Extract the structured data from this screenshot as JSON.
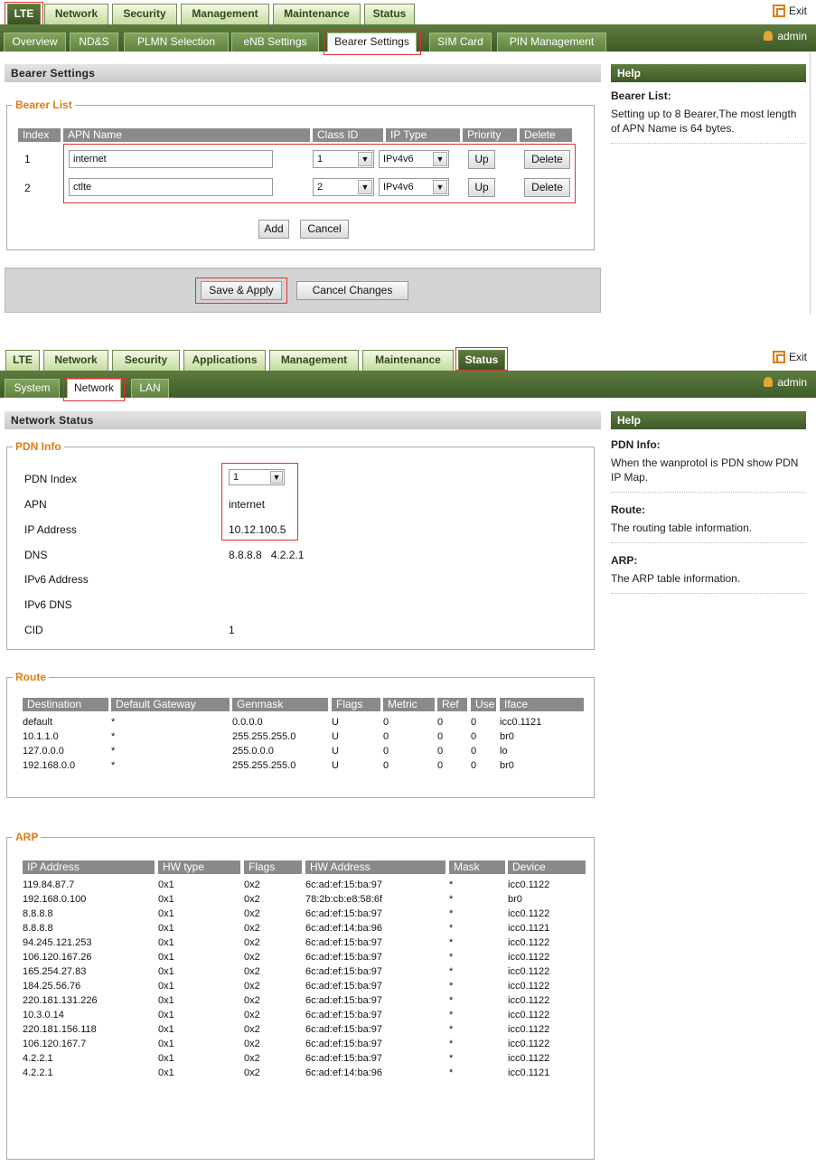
{
  "screen1": {
    "top_tabs": [
      "LTE",
      "Network",
      "Security",
      "Management",
      "Maintenance",
      "Status"
    ],
    "exit_label": "Exit",
    "sub_tabs": [
      "Overview",
      "ND&S",
      "PLMN Selection",
      "eNB Settings",
      "Bearer Settings",
      "SIM Card",
      "PIN Management"
    ],
    "admin_label": "admin",
    "section_title": "Bearer Settings",
    "help_title": "Help",
    "help_items": [
      {
        "heading": "Bearer List:",
        "text": "Setting up to 8 Bearer,The most length of APN Name is 64 bytes."
      }
    ],
    "bearer_legend": "Bearer List",
    "bearer_headers": [
      "Index",
      "APN Name",
      "Class ID",
      "IP Type",
      "Priority",
      "Delete"
    ],
    "bearer_rows": [
      {
        "index": "1",
        "apn": "internet",
        "class_id": "1",
        "ip_type": "IPv4v6",
        "priority": "Up",
        "delete": "Delete"
      },
      {
        "index": "2",
        "apn": "ctlte",
        "class_id": "2",
        "ip_type": "IPv4v6",
        "priority": "Up",
        "delete": "Delete"
      }
    ],
    "add_label": "Add",
    "cancel_label": "Cancel",
    "save_label": "Save & Apply",
    "cancel_changes_label": "Cancel Changes"
  },
  "screen2": {
    "top_tabs": [
      "LTE",
      "Network",
      "Security",
      "Applications",
      "Management",
      "Maintenance",
      "Status"
    ],
    "exit_label": "Exit",
    "sub_tabs": [
      "System",
      "Network",
      "LAN"
    ],
    "admin_label": "admin",
    "section_title": "Network Status",
    "help_title": "Help",
    "help_items": [
      {
        "heading": "PDN Info:",
        "text": "When the wanprotol is PDN show PDN IP Map."
      },
      {
        "heading": "Route:",
        "text": "The routing table information."
      },
      {
        "heading": "ARP:",
        "text": "The ARP table information."
      }
    ],
    "pdn_legend": "PDN Info",
    "pdn_fields": [
      {
        "label": "PDN Index",
        "value": "1"
      },
      {
        "label": "APN",
        "value": "internet"
      },
      {
        "label": "IP Address",
        "value": "10.12.100.5"
      },
      {
        "label": "DNS",
        "value": "8.8.8.8   4.2.2.1"
      },
      {
        "label": "IPv6 Address",
        "value": ""
      },
      {
        "label": "IPv6 DNS",
        "value": ""
      },
      {
        "label": "CID",
        "value": "1"
      }
    ],
    "route_legend": "Route",
    "route_headers": [
      "Destination",
      "Default Gateway",
      "Genmask",
      "Flags",
      "Metric",
      "Ref",
      "Use",
      "Iface"
    ],
    "route_rows": [
      [
        "default",
        "*",
        "0.0.0.0",
        "U",
        "0",
        "0",
        "0",
        "icc0.1121"
      ],
      [
        "10.1.1.0",
        "*",
        "255.255.255.0",
        "U",
        "0",
        "0",
        "0",
        "br0"
      ],
      [
        "127.0.0.0",
        "*",
        "255.0.0.0",
        "U",
        "0",
        "0",
        "0",
        "lo"
      ],
      [
        "192.168.0.0",
        "*",
        "255.255.255.0",
        "U",
        "0",
        "0",
        "0",
        "br0"
      ]
    ],
    "arp_legend": "ARP",
    "arp_headers": [
      "IP Address",
      "HW type",
      "Flags",
      "HW Address",
      "Mask",
      "Device"
    ],
    "arp_rows": [
      [
        "119.84.87.7",
        "0x1",
        "0x2",
        "6c:ad:ef:15:ba:97",
        "*",
        "icc0.1122"
      ],
      [
        "192.168.0.100",
        "0x1",
        "0x2",
        "78:2b:cb:e8:58:6f",
        "*",
        "br0"
      ],
      [
        "8.8.8.8",
        "0x1",
        "0x2",
        "6c:ad:ef:15:ba:97",
        "*",
        "icc0.1122"
      ],
      [
        "8.8.8.8",
        "0x1",
        "0x2",
        "6c:ad:ef:14:ba:96",
        "*",
        "icc0.1121"
      ],
      [
        "94.245.121.253",
        "0x1",
        "0x2",
        "6c:ad:ef:15:ba:97",
        "*",
        "icc0.1122"
      ],
      [
        "106.120.167.26",
        "0x1",
        "0x2",
        "6c:ad:ef:15:ba:97",
        "*",
        "icc0.1122"
      ],
      [
        "165.254.27.83",
        "0x1",
        "0x2",
        "6c:ad:ef:15:ba:97",
        "*",
        "icc0.1122"
      ],
      [
        "184.25.56.76",
        "0x1",
        "0x2",
        "6c:ad:ef:15:ba:97",
        "*",
        "icc0.1122"
      ],
      [
        "220.181.131.226",
        "0x1",
        "0x2",
        "6c:ad:ef:15:ba:97",
        "*",
        "icc0.1122"
      ],
      [
        "10.3.0.14",
        "0x1",
        "0x2",
        "6c:ad:ef:15:ba:97",
        "*",
        "icc0.1122"
      ],
      [
        "220.181.156.118",
        "0x1",
        "0x2",
        "6c:ad:ef:15:ba:97",
        "*",
        "icc0.1122"
      ],
      [
        "106.120.167.7",
        "0x1",
        "0x2",
        "6c:ad:ef:15:ba:97",
        "*",
        "icc0.1122"
      ],
      [
        "4.2.2.1",
        "0x1",
        "0x2",
        "6c:ad:ef:15:ba:97",
        "*",
        "icc0.1122"
      ],
      [
        "4.2.2.1",
        "0x1",
        "0x2",
        "6c:ad:ef:14:ba:96",
        "*",
        "icc0.1121"
      ]
    ]
  }
}
